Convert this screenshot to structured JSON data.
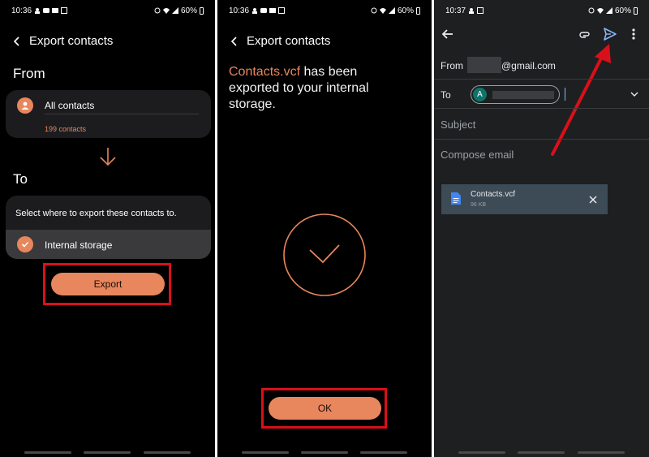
{
  "panel1": {
    "status": {
      "time": "10:36",
      "battery": "60%"
    },
    "title": "Export contacts",
    "from_label": "From",
    "source": {
      "name": "All contacts",
      "count": "199 contacts"
    },
    "to_label": "To",
    "dest_prompt": "Select where to export these contacts to.",
    "dest_option": "Internal storage",
    "export_button": "Export"
  },
  "panel2": {
    "status": {
      "time": "10:36",
      "battery": "60%"
    },
    "title": "Export contacts",
    "message_file": "Contacts.vcf",
    "message_rest": " has been exported to your internal storage.",
    "ok_button": "OK"
  },
  "panel3": {
    "status": {
      "time": "10:37",
      "battery": "60%"
    },
    "from_label": "From",
    "from_email_suffix": "@gmail.com",
    "to_label": "To",
    "to_chip_initial": "A",
    "subject_placeholder": "Subject",
    "body_placeholder": "Compose email",
    "attachment": {
      "name": "Contacts.vcf",
      "size": "96 KB"
    }
  },
  "colors": {
    "accent": "#e8865d",
    "highlight_red": "#d9101a",
    "gmail_send": "#8ab4f8",
    "chip_avatar": "#0e7469"
  }
}
